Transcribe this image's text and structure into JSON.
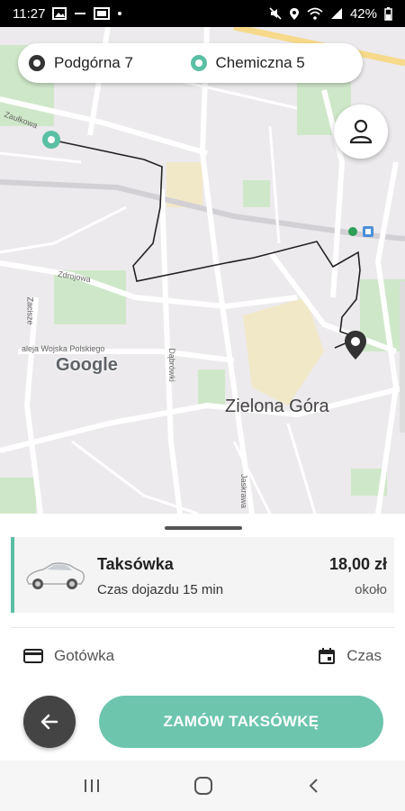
{
  "status_bar": {
    "time": "11:27",
    "battery": "42%",
    "left_icons": [
      "gallery-icon",
      "minus-icon",
      "image-icon",
      "dot-icon"
    ],
    "right_icons": [
      "mute-icon",
      "location-icon",
      "wifi-icon",
      "signal-icon",
      "battery-icon"
    ]
  },
  "route": {
    "from": "Podgórna 7",
    "to": "Chemiczna 5"
  },
  "map": {
    "city_label": "Zielona Góra",
    "google_logo": "Google",
    "street_labels": [
      "Zaułkowa",
      "Zdrojowa",
      "Zacisze",
      "aleja Wojska Polskiego",
      "Dąbrówki",
      "Jaskrawa"
    ],
    "colors": {
      "route": "#222222",
      "marker_start": "#5bbfa4",
      "marker_end": "#333333"
    }
  },
  "ride": {
    "name": "Taksówka",
    "eta": "Czas dojazdu 15 min",
    "price": "18,00 zł",
    "approx": "około"
  },
  "options": {
    "payment": "Gotówka",
    "time": "Czas"
  },
  "actions": {
    "order": "ZAMÓW TAKSÓWKĘ"
  },
  "colors": {
    "accent": "#5bbfa4",
    "order_button": "#6dc5ae",
    "back_button": "#444444"
  }
}
